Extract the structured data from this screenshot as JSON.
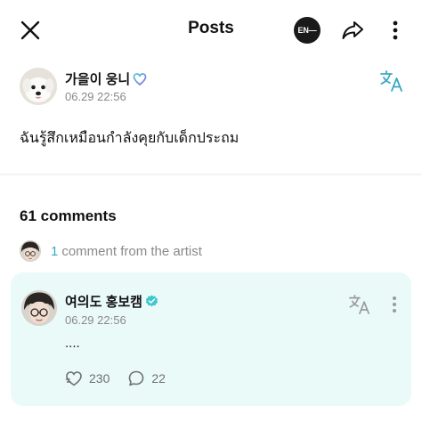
{
  "header": {
    "title": "Posts",
    "brand_logo_text": "EN—",
    "icons": {
      "close": "close-icon",
      "share": "share-icon",
      "more": "more-vertical-icon"
    }
  },
  "post": {
    "author_name": "가을이 웅니",
    "time": "06.29 22:56",
    "body": "ฉันรู้สึกเหมือนกำลังคุยกับเด็กประถม",
    "icons": {
      "badge": "heart-badge-icon",
      "translate": "translate-icon"
    }
  },
  "comments": {
    "count_label": "61 comments",
    "artist_count": "1",
    "artist_label": "comment from the artist"
  },
  "artist_comment": {
    "author_name": "여의도 홍보캠",
    "time": "06.29 22:56",
    "text": "....",
    "likes": "230",
    "replies": "22",
    "icons": {
      "badge": "verified-badge-icon",
      "translate": "translate-icon",
      "more": "more-vertical-icon",
      "like": "like-icon",
      "reply": "reply-icon"
    }
  },
  "colors": {
    "accent": "#3aa8c2",
    "card_bg": "#eafaf8",
    "muted_text": "#8a8a8a"
  }
}
